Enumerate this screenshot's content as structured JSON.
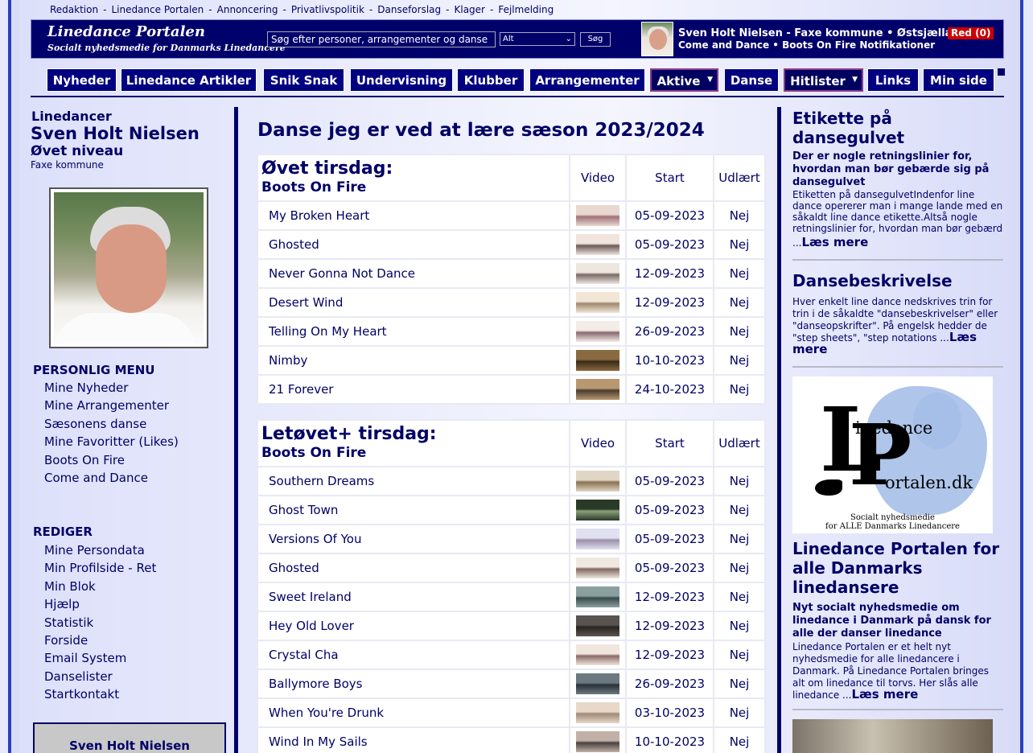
{
  "top_links": [
    "Redaktion",
    "Linedance Portalen",
    "Annoncering",
    "Privatlivspolitik",
    "Danseforslag",
    "Klager",
    "Fejlmelding"
  ],
  "header": {
    "logo_title": "Linedance Portalen",
    "logo_subtitle": "Socialt nyhedsmedie for Danmarks Linedancere",
    "search_placeholder": "Søg efter personer, arrangementer og danse",
    "search_select": "Alt",
    "search_button": "Søg",
    "user_line1": "Sven Holt Nielsen - Faxe  kommune • Østsjælland",
    "user_line2_clubs": "Come and Dance • Boots On Fire",
    "user_line2_notif": "Notifikationer",
    "red_badge": "Red (0)"
  },
  "nav": [
    {
      "label": "Nyheder"
    },
    {
      "label": "Linedance Artikler"
    },
    {
      "label": "Snik Snak"
    },
    {
      "label": "Undervisning"
    },
    {
      "label": "Klubber"
    },
    {
      "label": "Arrangementer"
    },
    {
      "label": "Aktive"
    },
    {
      "label": "Danse"
    },
    {
      "label": "Hitlister"
    },
    {
      "label": "Links"
    },
    {
      "label": "Min side"
    }
  ],
  "profile": {
    "role": "Linedancer",
    "name": "Sven Holt Nielsen",
    "level": "Øvet niveau",
    "municipality": "Faxe kommune"
  },
  "personal_menu": {
    "heading": "PERSONLIG MENU",
    "items": [
      "Mine Nyheder",
      "Mine Arrangementer",
      "Sæsonens danse",
      "Mine Favoritter (Likes)",
      "Boots On Fire",
      "Come and Dance"
    ]
  },
  "edit_menu": {
    "heading": "REDIGER",
    "items": [
      "Mine Persondata",
      "Min Profilside - Ret",
      "Min Blok",
      "Hjælp",
      "Statistik",
      "Forside",
      "Email System",
      "Danselister",
      "Startkontakt"
    ]
  },
  "name_box": "Sven Holt Nielsen",
  "main": {
    "title": "Danse jeg er ved at lære sæson 2023/2024",
    "columns": {
      "video": "Video",
      "start": "Start",
      "learned": "Udlært"
    },
    "groups": [
      {
        "title": "Øvet  tirsdag:",
        "club": "Boots On Fire",
        "rows": [
          {
            "name": "My Broken Heart",
            "start": "05-09-2023",
            "learned": "Nej"
          },
          {
            "name": "Ghosted",
            "start": "05-09-2023",
            "learned": "Nej"
          },
          {
            "name": "Never Gonna Not Dance",
            "start": "12-09-2023",
            "learned": "Nej"
          },
          {
            "name": "Desert Wind",
            "start": "12-09-2023",
            "learned": "Nej"
          },
          {
            "name": "Telling On My Heart",
            "start": "26-09-2023",
            "learned": "Nej"
          },
          {
            "name": "Nimby",
            "start": "10-10-2023",
            "learned": "Nej"
          },
          {
            "name": "21 Forever",
            "start": "24-10-2023",
            "learned": "Nej"
          }
        ]
      },
      {
        "title": "Letøvet+  tirsdag:",
        "club": "Boots On Fire",
        "rows": [
          {
            "name": "Southern Dreams",
            "start": "05-09-2023",
            "learned": "Nej"
          },
          {
            "name": "Ghost Town",
            "start": "05-09-2023",
            "learned": "Nej"
          },
          {
            "name": "Versions Of You",
            "start": "05-09-2023",
            "learned": "Nej"
          },
          {
            "name": "Ghosted",
            "start": "05-09-2023",
            "learned": "Nej"
          },
          {
            "name": "Sweet Ireland",
            "start": "12-09-2023",
            "learned": "Nej"
          },
          {
            "name": "Hey Old Lover",
            "start": "12-09-2023",
            "learned": "Nej"
          },
          {
            "name": "Crystal Cha",
            "start": "12-09-2023",
            "learned": "Nej"
          },
          {
            "name": "Ballymore Boys",
            "start": "26-09-2023",
            "learned": "Nej"
          },
          {
            "name": "When You're Drunk",
            "start": "03-10-2023",
            "learned": "Nej"
          },
          {
            "name": "Wind In My Sails",
            "start": "10-10-2023",
            "learned": "Nej"
          }
        ]
      }
    ]
  },
  "right": {
    "etiquette": {
      "title": "Etikette på dansegulvet",
      "lead": "Der er nogle retningslinier for, hvordan man bør gebærde sig på dansegulvet",
      "text": "Etiketten på dansegulvetIndenfor line dance opererer man i mange lande med en såkaldt line dance etikette.Altså nogle retningslinier for, hvordan man bør gebærd",
      "more_prefix": "...",
      "more": "Læs mere"
    },
    "description": {
      "title": "Dansebeskrivelse",
      "text": "Hver enkelt line dance nedskrives trin for trin i de såkaldte \"dansebeskrivelser\" eller \"danseopskrifter\". På engelsk hedder de \"step sheets\", \"step notations ...",
      "more": "Læs mere"
    },
    "logo": {
      "text1": "inedance",
      "text2": "ortalen.dk",
      "tagline1": "Socialt nyhedsmedie",
      "tagline2": "for ALLE Danmarks Linedancere"
    },
    "portal": {
      "title": "Linedance Portalen for alle Danmarks linedansere",
      "lead": "Nyt socialt nyhedsmedie om linedance i Danmark på dansk for alle der danser linedance",
      "text": "Linedance Portalen er et helt nyt nyhedsmedie for alle linedancere i Danmark. På Linedance Portalen bringes alt om linedance til torvs. Her slås alle linedance ...",
      "more": "Læs mere"
    }
  }
}
